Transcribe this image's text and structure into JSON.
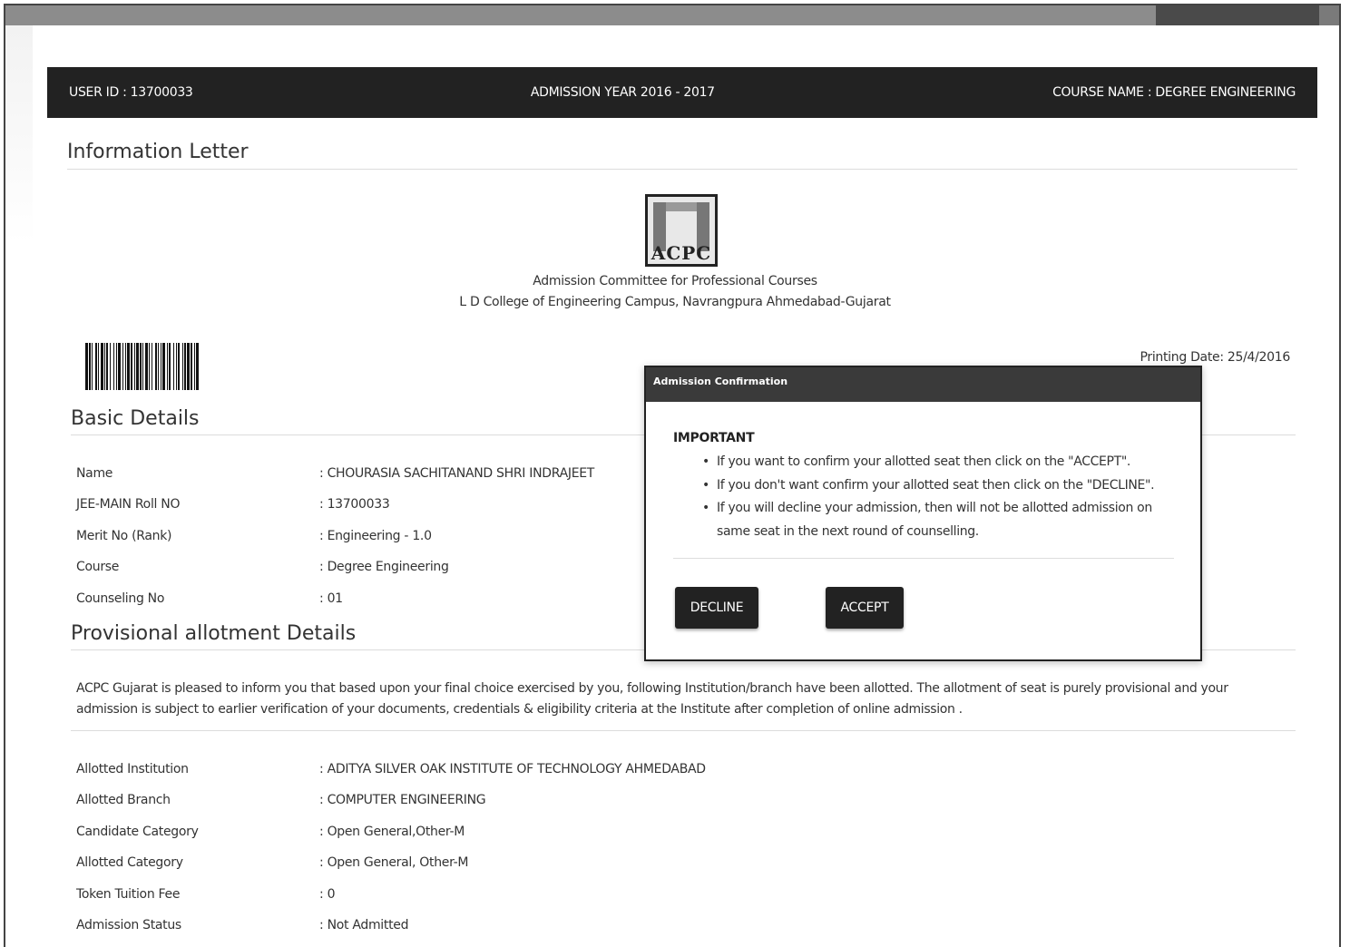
{
  "header": {
    "user_id": "USER ID : 13700033",
    "admission_year": "ADMISSION YEAR 2016 - 2017",
    "course_name": "COURSE NAME : DEGREE ENGINEERING"
  },
  "letter": {
    "title": "Information Letter",
    "logo_text": "ACPC",
    "org_name": "Admission Committee for Professional Courses",
    "org_address": "L D College of Engineering Campus, Navrangpura Ahmedabad-Gujarat",
    "printing_date": "Printing Date: 25/4/2016"
  },
  "basic_details": {
    "title": "Basic Details",
    "rows": [
      {
        "label": "Name",
        "value": ": CHOURASIA SACHITANAND SHRI INDRAJEET"
      },
      {
        "label": "JEE-MAIN Roll NO",
        "value": ": 13700033"
      },
      {
        "label": "Merit No (Rank)",
        "value": ": Engineering - 1.0"
      },
      {
        "label": "Course",
        "value": ": Degree Engineering"
      },
      {
        "label": "Counseling No",
        "value": ": 01"
      }
    ]
  },
  "allotment": {
    "title": "Provisional allotment Details",
    "paragraph": "ACPC Gujarat is pleased to inform you that based upon your final choice exercised by you, following Institution/branch have been allotted. The allotment of seat is purely provisional and your admission is subject to earlier verification of your documents, credentials & eligibility criteria at the Institute after completion of online admission .",
    "rows": [
      {
        "label": "Allotted Institution",
        "value": ": ADITYA SILVER OAK INSTITUTE OF TECHNOLOGY AHMEDABAD"
      },
      {
        "label": "Allotted Branch",
        "value": ": COMPUTER ENGINEERING"
      },
      {
        "label": "Candidate Category",
        "value": ": Open General,Other-M"
      },
      {
        "label": "Allotted Category",
        "value": ": Open General, Other-M"
      },
      {
        "label": "Token Tuition Fee",
        "value": ": 0"
      },
      {
        "label": "Admission Status",
        "value": ": Not Admitted"
      }
    ]
  },
  "modal": {
    "title": "Admission Confirmation",
    "important": "IMPORTANT",
    "items": [
      "If you want to confirm your allotted seat then click on the \"ACCEPT\".",
      "If you don't want confirm your allotted seat then click on the \"DECLINE\".",
      "If you will decline your admission, then will not be allotted admission on same seat in the next round of counselling."
    ],
    "decline_label": "DECLINE",
    "accept_label": "ACCEPT"
  }
}
